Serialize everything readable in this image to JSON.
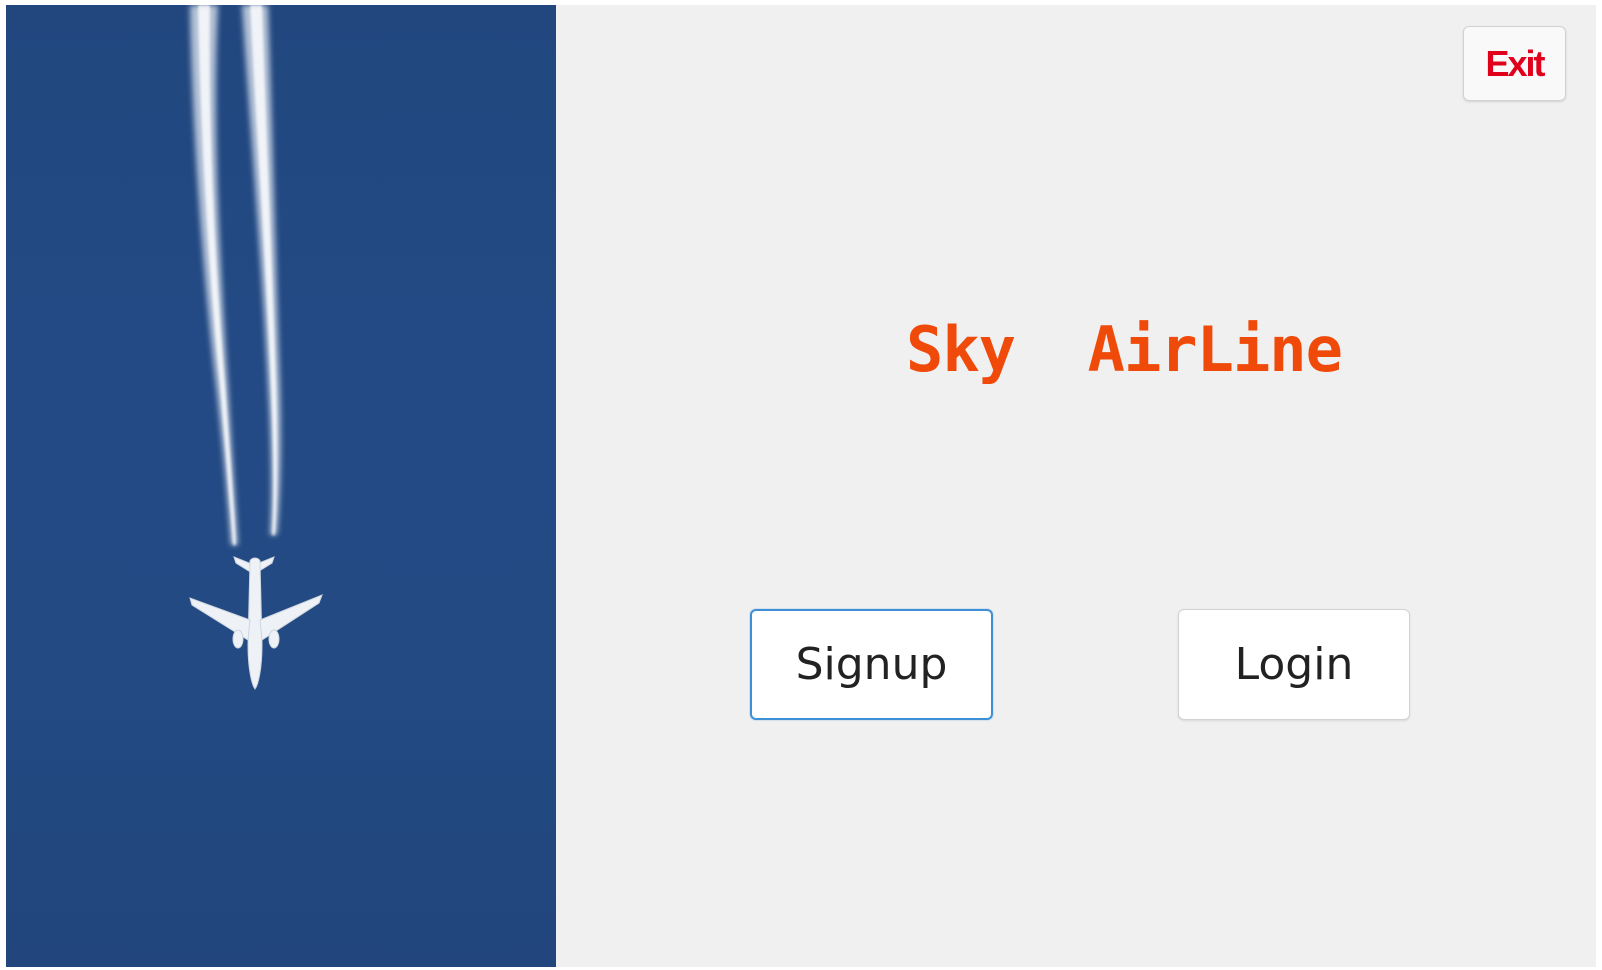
{
  "window": {
    "title_text": "Sky  AirLine",
    "accent_color": "#f04a0a",
    "exit_color": "#e0001b"
  },
  "image_panel": {
    "scene": "airplane-with-contrails-icon",
    "sky_color": "#234a84"
  },
  "toolbar": {
    "exit_label": "Exit"
  },
  "actions": {
    "signup_label": "Signup",
    "login_label": "Login"
  }
}
